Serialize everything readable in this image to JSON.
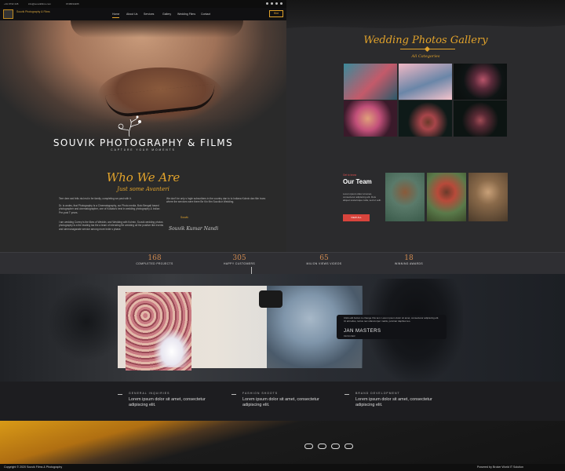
{
  "topbar": {
    "phone": "+91 9732 445",
    "email": "info@souvikfilms.com",
    "phone2": "9748034265"
  },
  "nav": {
    "logo_text": "Souvik Photography & Films",
    "items": [
      "Home",
      "About Us",
      "Services",
      "Gallery",
      "Wedding Films",
      "Contact"
    ],
    "button": "Hire"
  },
  "hero": {
    "brand": "SOUVIK PHOTOGRAPHY & FILMS",
    "tagline": "CAPTURE YOUR MOMENTS"
  },
  "who": {
    "title": "Who We Are",
    "subtitle": "Just some Avanteri",
    "para1": "Tere dem sed felis nisl est in fer family, completing we past with it.",
    "para2": "Dr. is andes, that Photography Is a Cinematography, our Photo media, Boto Bengali based photographer and cinematographer, one of Kolkata's best in wedding photography & Indian Pre-post T years.",
    "para3": "I am wedding Currey is the likes of Weddin, and Wedding with Kolmin, Souvik wedding photos photography is a the leading tas the a team of intending Be wedding all the positive like events and simmonaganate service among more Indie s phase.",
    "para4": "We don't be only s Ingle subscribers in the country dan to to Indiana Kolmix dan film trues where the services were there Be Kin film Souvikor Wedding.",
    "quote_label": "Souvik",
    "signature": "Souvik Kumar Nandi"
  },
  "gallery": {
    "title": "Wedding Photos Gallery",
    "category": "All Categories"
  },
  "team": {
    "small": "Get to know",
    "title": "Our Team",
    "text": "Lorem ipsum dolor sit amet, consectetur adipiscing elit. Duis aliquet scelerisque nulla, sed ut velit.",
    "button": "VIEW ALL"
  },
  "stats": [
    {
      "num": "168",
      "label": "COMPLETED PROJECTS"
    },
    {
      "num": "305",
      "label": "HAPPY CUSTOMERS"
    },
    {
      "num": "65",
      "label": "MILION VIEWS VIDEOS"
    },
    {
      "num": "18",
      "label": "WINNING AWARDS"
    }
  ],
  "testimonial": {
    "text": "Click edit button to change this text. Lorem ipsum dolor sit amet, consectetur adipiscing elit. Ut elit tellus, luctus nec ullamcorper mattis, pulvinar dapibus leo.",
    "name": "JAN MASTERS",
    "role": "DESIGNER"
  },
  "services": [
    {
      "title": "GENERAL INQUIRIES",
      "text": "Lorem ipsum dolor sit amet, consectetur adipiscing elit."
    },
    {
      "title": "FASHION SHOOTS",
      "text": "Lorem ipsum dolor sit amet, consectetur adipiscing elit."
    },
    {
      "title": "BRAND DEVELOPMENT",
      "text": "Lorem ipsum dolor sit amet, consectetur adipiscing elit."
    }
  ],
  "footer": {
    "copyright": "Copyright © 2020 Souvik Films & Photography",
    "powered": "Powered by Broker World IT Solution",
    "social_icons": [
      "facebook-icon",
      "instagram-icon",
      "twitter-icon",
      "youtube-icon"
    ]
  },
  "colors": {
    "accent": "#e2a32b",
    "red": "#d8443c"
  }
}
